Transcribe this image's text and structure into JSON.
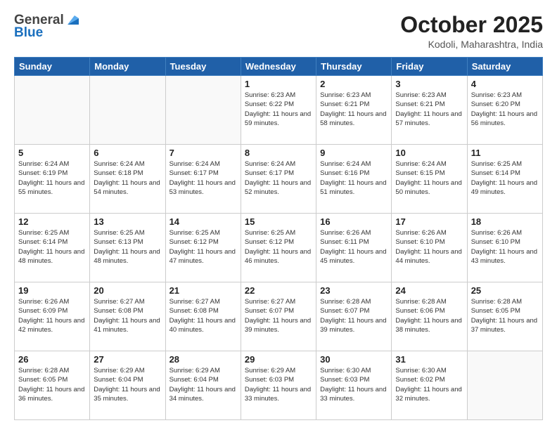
{
  "header": {
    "logo_general": "General",
    "logo_blue": "Blue",
    "month_title": "October 2025",
    "location": "Kodoli, Maharashtra, India"
  },
  "days_of_week": [
    "Sunday",
    "Monday",
    "Tuesday",
    "Wednesday",
    "Thursday",
    "Friday",
    "Saturday"
  ],
  "weeks": [
    [
      {
        "day": "",
        "info": ""
      },
      {
        "day": "",
        "info": ""
      },
      {
        "day": "",
        "info": ""
      },
      {
        "day": "1",
        "info": "Sunrise: 6:23 AM\nSunset: 6:22 PM\nDaylight: 11 hours\nand 59 minutes."
      },
      {
        "day": "2",
        "info": "Sunrise: 6:23 AM\nSunset: 6:21 PM\nDaylight: 11 hours\nand 58 minutes."
      },
      {
        "day": "3",
        "info": "Sunrise: 6:23 AM\nSunset: 6:21 PM\nDaylight: 11 hours\nand 57 minutes."
      },
      {
        "day": "4",
        "info": "Sunrise: 6:23 AM\nSunset: 6:20 PM\nDaylight: 11 hours\nand 56 minutes."
      }
    ],
    [
      {
        "day": "5",
        "info": "Sunrise: 6:24 AM\nSunset: 6:19 PM\nDaylight: 11 hours\nand 55 minutes."
      },
      {
        "day": "6",
        "info": "Sunrise: 6:24 AM\nSunset: 6:18 PM\nDaylight: 11 hours\nand 54 minutes."
      },
      {
        "day": "7",
        "info": "Sunrise: 6:24 AM\nSunset: 6:17 PM\nDaylight: 11 hours\nand 53 minutes."
      },
      {
        "day": "8",
        "info": "Sunrise: 6:24 AM\nSunset: 6:17 PM\nDaylight: 11 hours\nand 52 minutes."
      },
      {
        "day": "9",
        "info": "Sunrise: 6:24 AM\nSunset: 6:16 PM\nDaylight: 11 hours\nand 51 minutes."
      },
      {
        "day": "10",
        "info": "Sunrise: 6:24 AM\nSunset: 6:15 PM\nDaylight: 11 hours\nand 50 minutes."
      },
      {
        "day": "11",
        "info": "Sunrise: 6:25 AM\nSunset: 6:14 PM\nDaylight: 11 hours\nand 49 minutes."
      }
    ],
    [
      {
        "day": "12",
        "info": "Sunrise: 6:25 AM\nSunset: 6:14 PM\nDaylight: 11 hours\nand 48 minutes."
      },
      {
        "day": "13",
        "info": "Sunrise: 6:25 AM\nSunset: 6:13 PM\nDaylight: 11 hours\nand 48 minutes."
      },
      {
        "day": "14",
        "info": "Sunrise: 6:25 AM\nSunset: 6:12 PM\nDaylight: 11 hours\nand 47 minutes."
      },
      {
        "day": "15",
        "info": "Sunrise: 6:25 AM\nSunset: 6:12 PM\nDaylight: 11 hours\nand 46 minutes."
      },
      {
        "day": "16",
        "info": "Sunrise: 6:26 AM\nSunset: 6:11 PM\nDaylight: 11 hours\nand 45 minutes."
      },
      {
        "day": "17",
        "info": "Sunrise: 6:26 AM\nSunset: 6:10 PM\nDaylight: 11 hours\nand 44 minutes."
      },
      {
        "day": "18",
        "info": "Sunrise: 6:26 AM\nSunset: 6:10 PM\nDaylight: 11 hours\nand 43 minutes."
      }
    ],
    [
      {
        "day": "19",
        "info": "Sunrise: 6:26 AM\nSunset: 6:09 PM\nDaylight: 11 hours\nand 42 minutes."
      },
      {
        "day": "20",
        "info": "Sunrise: 6:27 AM\nSunset: 6:08 PM\nDaylight: 11 hours\nand 41 minutes."
      },
      {
        "day": "21",
        "info": "Sunrise: 6:27 AM\nSunset: 6:08 PM\nDaylight: 11 hours\nand 40 minutes."
      },
      {
        "day": "22",
        "info": "Sunrise: 6:27 AM\nSunset: 6:07 PM\nDaylight: 11 hours\nand 39 minutes."
      },
      {
        "day": "23",
        "info": "Sunrise: 6:28 AM\nSunset: 6:07 PM\nDaylight: 11 hours\nand 39 minutes."
      },
      {
        "day": "24",
        "info": "Sunrise: 6:28 AM\nSunset: 6:06 PM\nDaylight: 11 hours\nand 38 minutes."
      },
      {
        "day": "25",
        "info": "Sunrise: 6:28 AM\nSunset: 6:05 PM\nDaylight: 11 hours\nand 37 minutes."
      }
    ],
    [
      {
        "day": "26",
        "info": "Sunrise: 6:28 AM\nSunset: 6:05 PM\nDaylight: 11 hours\nand 36 minutes."
      },
      {
        "day": "27",
        "info": "Sunrise: 6:29 AM\nSunset: 6:04 PM\nDaylight: 11 hours\nand 35 minutes."
      },
      {
        "day": "28",
        "info": "Sunrise: 6:29 AM\nSunset: 6:04 PM\nDaylight: 11 hours\nand 34 minutes."
      },
      {
        "day": "29",
        "info": "Sunrise: 6:29 AM\nSunset: 6:03 PM\nDaylight: 11 hours\nand 33 minutes."
      },
      {
        "day": "30",
        "info": "Sunrise: 6:30 AM\nSunset: 6:03 PM\nDaylight: 11 hours\nand 33 minutes."
      },
      {
        "day": "31",
        "info": "Sunrise: 6:30 AM\nSunset: 6:02 PM\nDaylight: 11 hours\nand 32 minutes."
      },
      {
        "day": "",
        "info": ""
      }
    ]
  ]
}
